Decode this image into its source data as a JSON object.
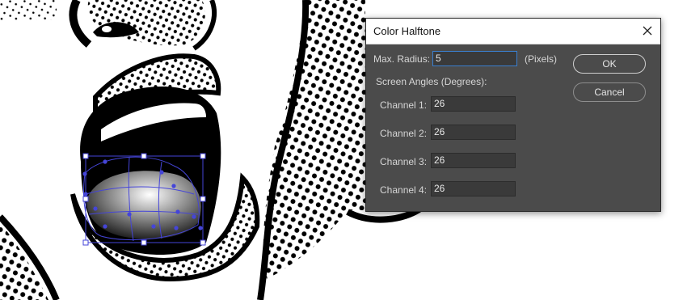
{
  "dialog": {
    "title": "Color Halftone",
    "close_icon": "close-icon",
    "max_radius": {
      "label": "Max. Radius:",
      "value": "5",
      "unit": "(Pixels)"
    },
    "screen_angles_heading": "Screen Angles (Degrees):",
    "channels": [
      {
        "label": "Channel 1:",
        "value": "26"
      },
      {
        "label": "Channel 2:",
        "value": "26"
      },
      {
        "label": "Channel 3:",
        "value": "26"
      },
      {
        "label": "Channel 4:",
        "value": "26"
      }
    ],
    "ok_label": "OK",
    "cancel_label": "Cancel"
  },
  "colors": {
    "dialog_bg": "#4b4b4b",
    "field_bg": "#3a3a3a",
    "focus_border": "#3a7fd0",
    "warp_handles": "#4545d8"
  }
}
